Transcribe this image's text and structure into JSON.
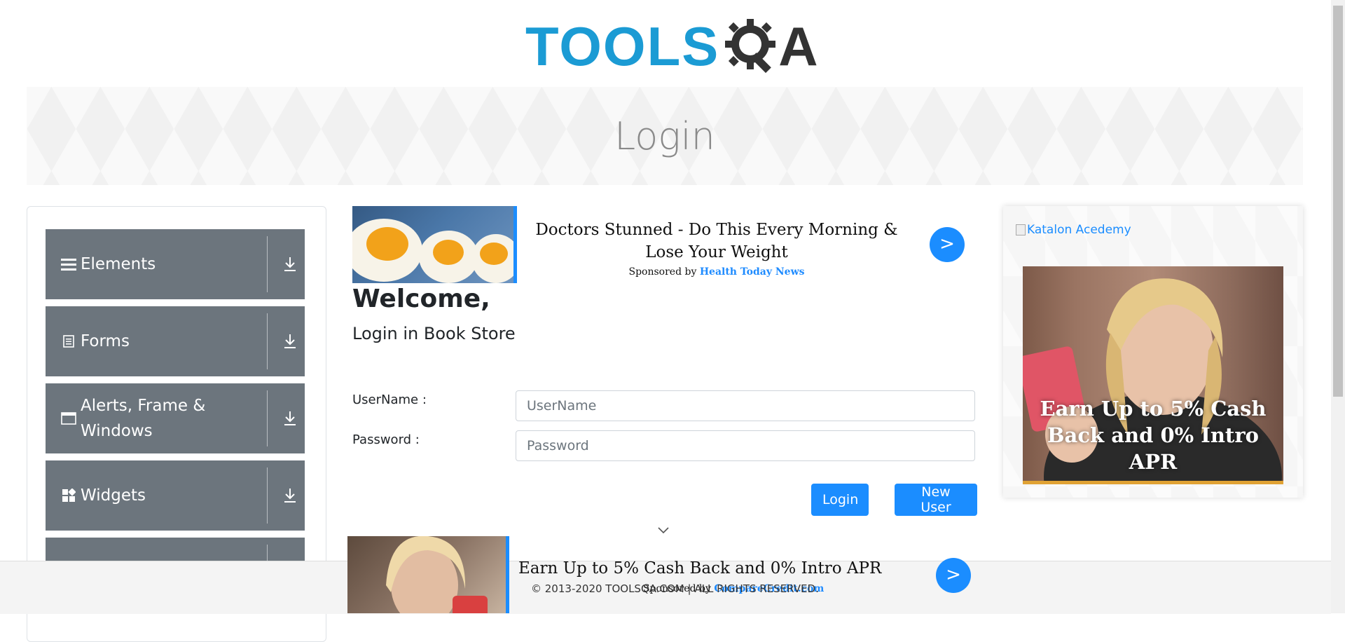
{
  "header": {
    "logo_main": "TOOLS",
    "logo_end": "A",
    "logo_alt": "ToolsQA"
  },
  "banner": {
    "title": "Login"
  },
  "sidebar": {
    "items": [
      {
        "label": "Elements",
        "icon": "hamburger-icon"
      },
      {
        "label": "Forms",
        "icon": "document-icon"
      },
      {
        "label": "Alerts, Frame & Windows",
        "icon": "window-icon"
      },
      {
        "label": "Widgets",
        "icon": "widgets-icon"
      }
    ]
  },
  "ad_top": {
    "headline": "Doctors Stunned - Do This Every Morning & Lose Your Weight",
    "sponsored_by": "Sponsored by",
    "sponsor": "Health Today News",
    "go": ">"
  },
  "main": {
    "welcome": "Welcome,",
    "subtitle": "Login in Book Store",
    "username_label": "UserName :",
    "password_label": "Password :",
    "username_placeholder": "UserName",
    "password_placeholder": "Password",
    "login_button": "Login",
    "new_user_button": "New User"
  },
  "ad_right": {
    "broken_image_alt": "Katalon Acedemy",
    "caption_line1": "Earn Up to 5% Cash",
    "caption_line2": "Back and 0% Intro APR"
  },
  "ad_bottom": {
    "headline": "Earn Up to 5% Cash Back and 0% Intro APR",
    "sponsored_by": "Sponsored by",
    "sponsor": "CompareCredit.com",
    "go": ">"
  },
  "footer": {
    "copyright": "© 2013-2020 TOOLSQA.COM | ALL RIGHTS RESERVED."
  },
  "colors": {
    "accent": "#1b8dff",
    "logo_blue": "#1b9bd4",
    "nav_bg": "#6c757d"
  }
}
